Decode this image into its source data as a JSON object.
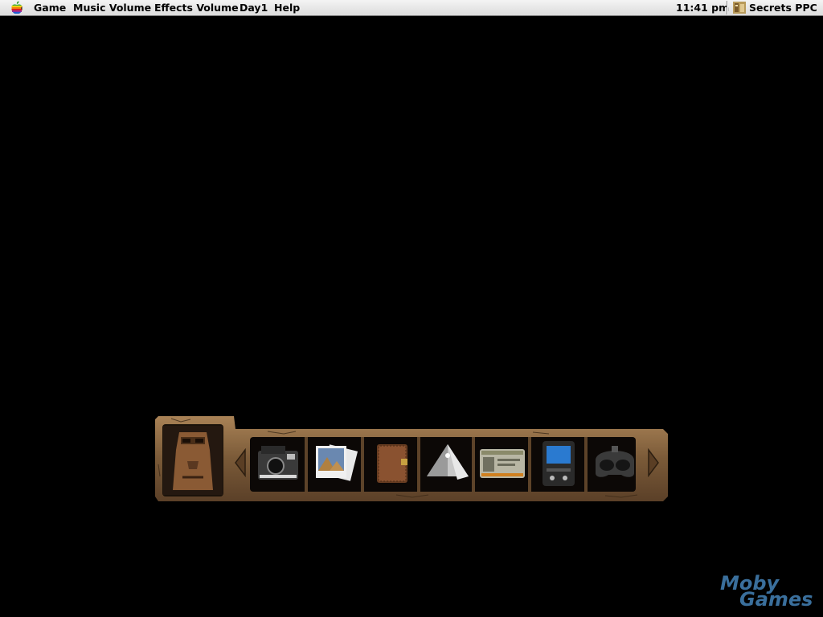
{
  "menubar": {
    "apple_icon": "apple-rainbow-icon",
    "items": [
      "Game",
      "Music Volume",
      "Effects Volume",
      "Day1",
      "Help"
    ],
    "clock": "11:41 pm",
    "app_icon": "secrets-app-icon",
    "app_name": "Secrets PPC"
  },
  "inventory": {
    "portrait_icon": "stone-idol-portrait-icon",
    "scroll_left_icon": "triangle-left-icon",
    "scroll_right_icon": "triangle-right-icon",
    "items": [
      {
        "name": "instant-camera-icon"
      },
      {
        "name": "pyramid-photos-icon"
      },
      {
        "name": "leather-wallet-icon"
      },
      {
        "name": "crystal-pyramid-icon"
      },
      {
        "name": "id-card-icon"
      },
      {
        "name": "handheld-device-icon"
      },
      {
        "name": "vr-headset-icon"
      }
    ]
  },
  "watermark": {
    "line1": "Moby",
    "line2": "Games"
  },
  "colors": {
    "background": "#000000",
    "menubar": "#e8e8e8",
    "frame_stone": "#7a5a38",
    "watermark": "#3a6f9c"
  }
}
